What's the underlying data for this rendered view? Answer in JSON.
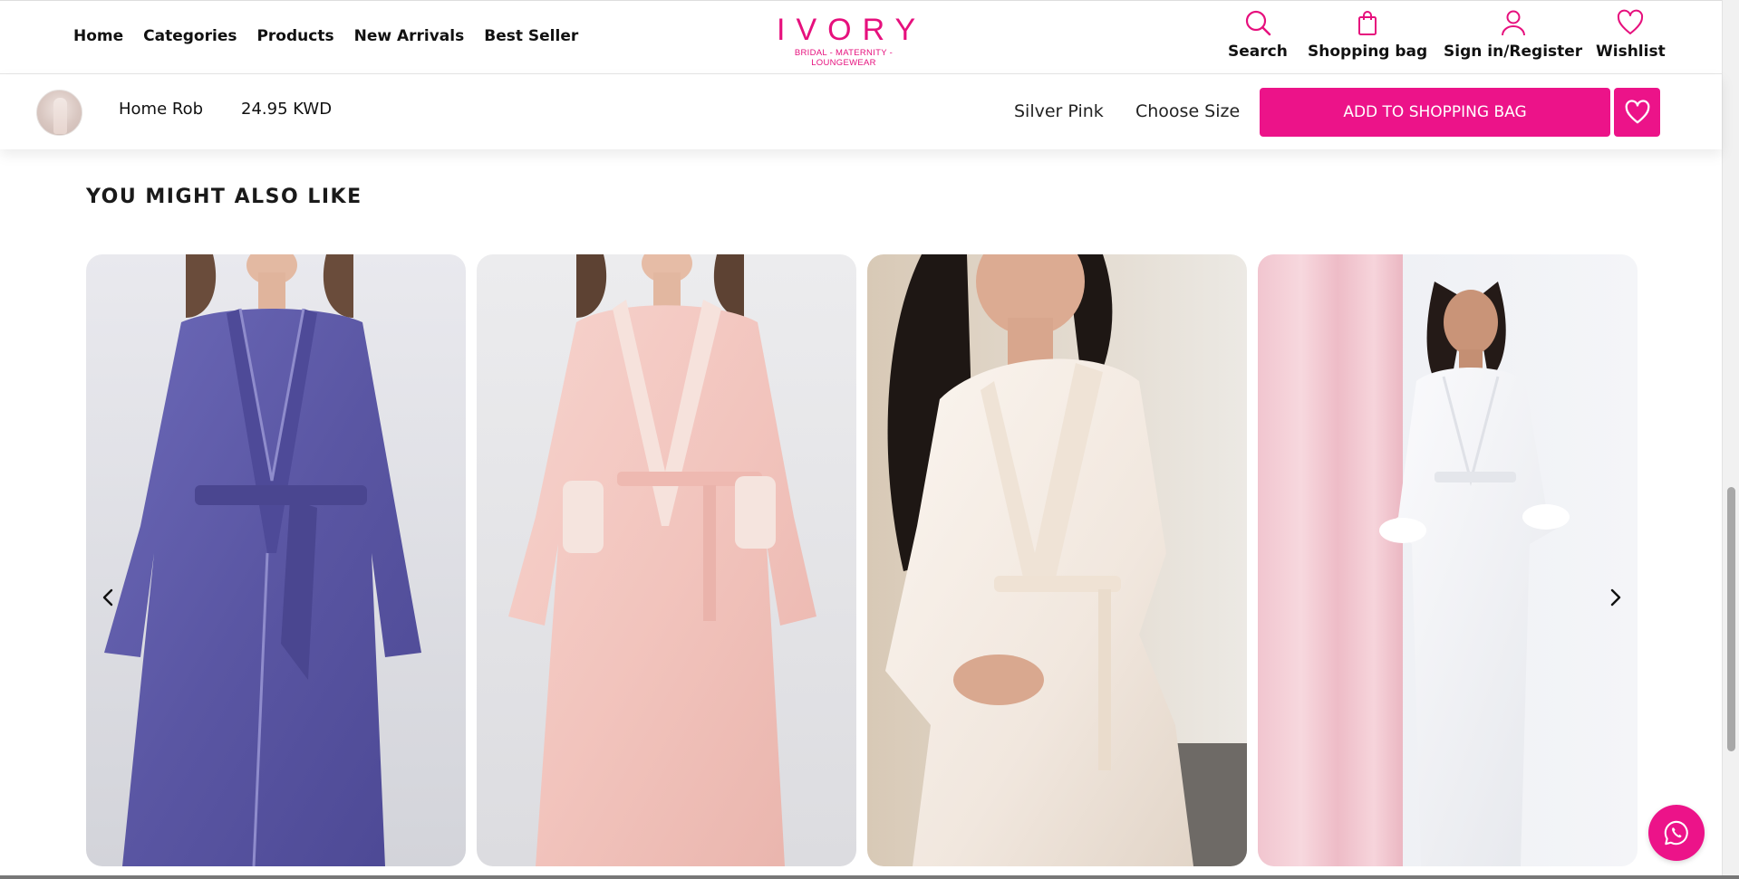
{
  "header": {
    "nav": [
      "Home",
      "Categories",
      "Products",
      "New Arrivals",
      "Best Seller"
    ],
    "logo": {
      "name": "IVORY",
      "tagline": "BRIDAL - MATERNITY - LOUNGEWEAR"
    },
    "actions": {
      "search": "Search",
      "bag": "Shopping bag",
      "account": "Sign in/Register",
      "wishlist": "Wishlist"
    }
  },
  "product_bar": {
    "name": "Home Rob",
    "price": "24.95 KWD",
    "color": "Silver Pink",
    "size": "Choose Size",
    "add_button": "ADD TO SHOPPING BAG"
  },
  "recommendations": {
    "title": "YOU MIGHT ALSO LIKE",
    "items": [
      {
        "robe_color": "#5d5aa8"
      },
      {
        "robe_color": "#f3c8c3"
      },
      {
        "robe_color": "#f4ede6"
      },
      {
        "robe_color": "#f2f3f6"
      }
    ]
  },
  "colors": {
    "brand_pink": "#ec1389",
    "logo_pink": "#e6107d"
  },
  "icons": [
    "search-icon",
    "shopping-bag-icon",
    "user-icon",
    "heart-icon",
    "chevron-left-icon",
    "chevron-right-icon",
    "whatsapp-icon"
  ]
}
